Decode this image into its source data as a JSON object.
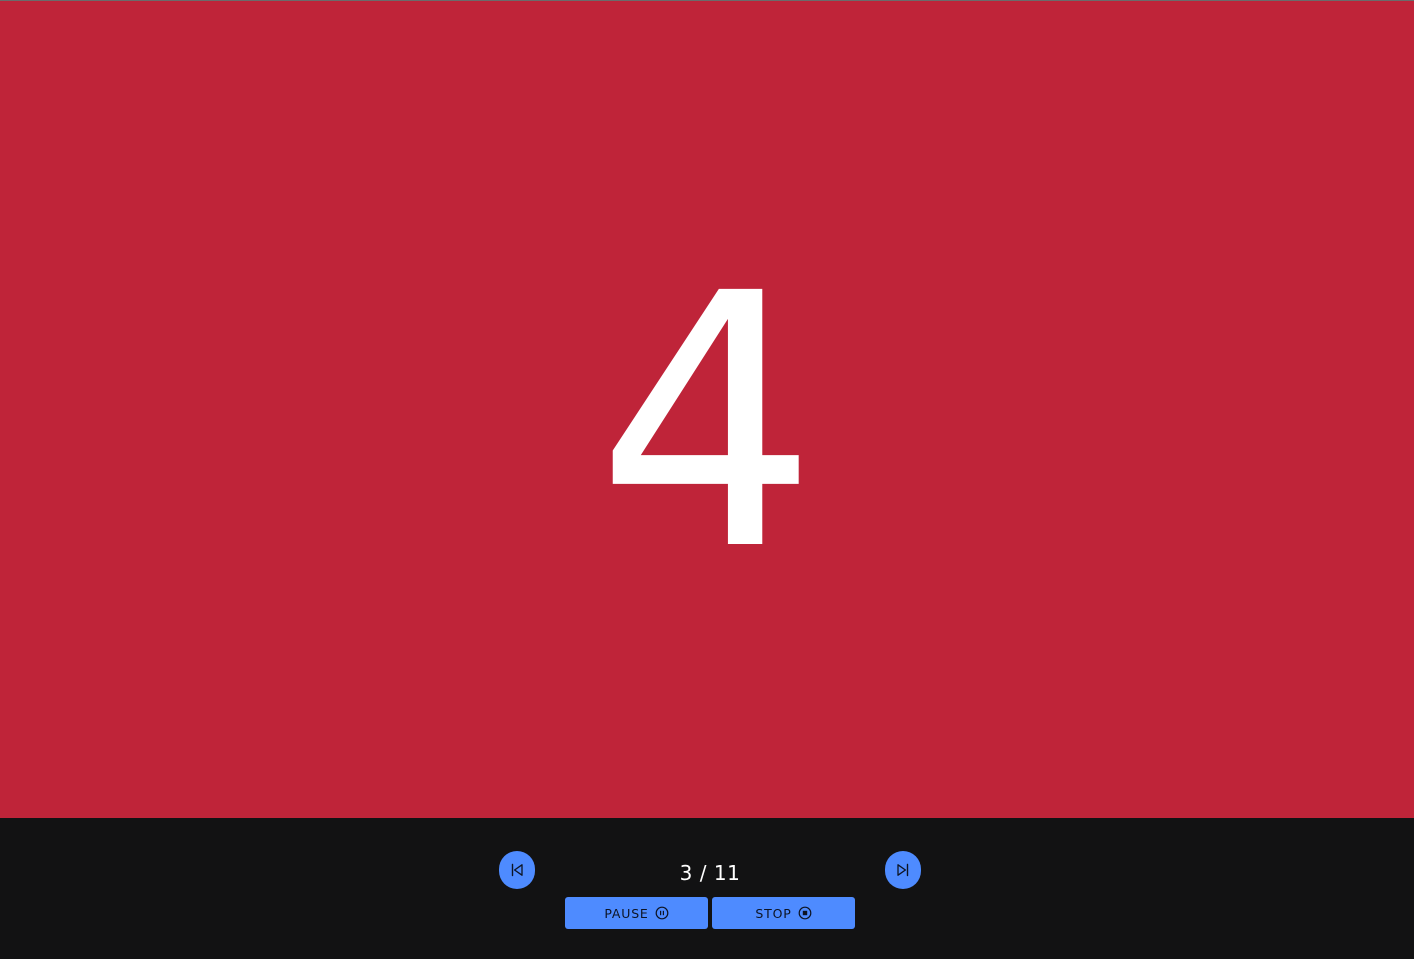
{
  "slide": {
    "background_color": "#bf2439",
    "content": "4"
  },
  "controls": {
    "background_color": "#121213",
    "accent_color": "#4e8bff",
    "counter": "3 / 11",
    "prev_icon": "skip-previous-icon",
    "next_icon": "skip-next-icon",
    "pause_label": "PAUSE",
    "pause_icon": "pause-circle-icon",
    "stop_label": "STOP",
    "stop_icon": "stop-circle-icon"
  }
}
